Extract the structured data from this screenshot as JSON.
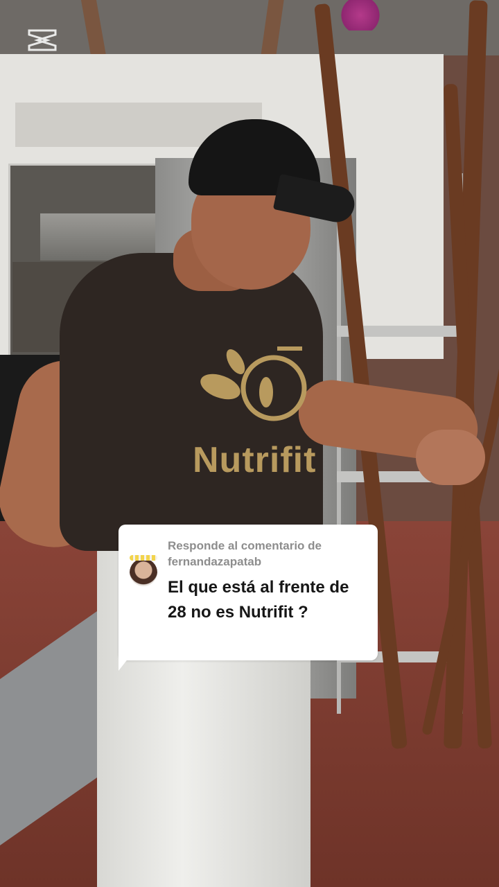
{
  "app": {
    "watermark_icon": "capcut-logo-icon"
  },
  "shirt": {
    "brand_text": "Nutrifit",
    "logo_icon": "leaves-fork-icon"
  },
  "reply_card": {
    "header_line1": "Responde al comentario de",
    "header_line2": "fernandazapatab",
    "comment_text": "El que está al frente de 28 no es Nutrifit ?",
    "avatar_icon": "avatar-icon"
  },
  "colors": {
    "card_background": "#ffffff",
    "card_header_text": "#8d8d8d",
    "card_body_text": "#161616"
  }
}
